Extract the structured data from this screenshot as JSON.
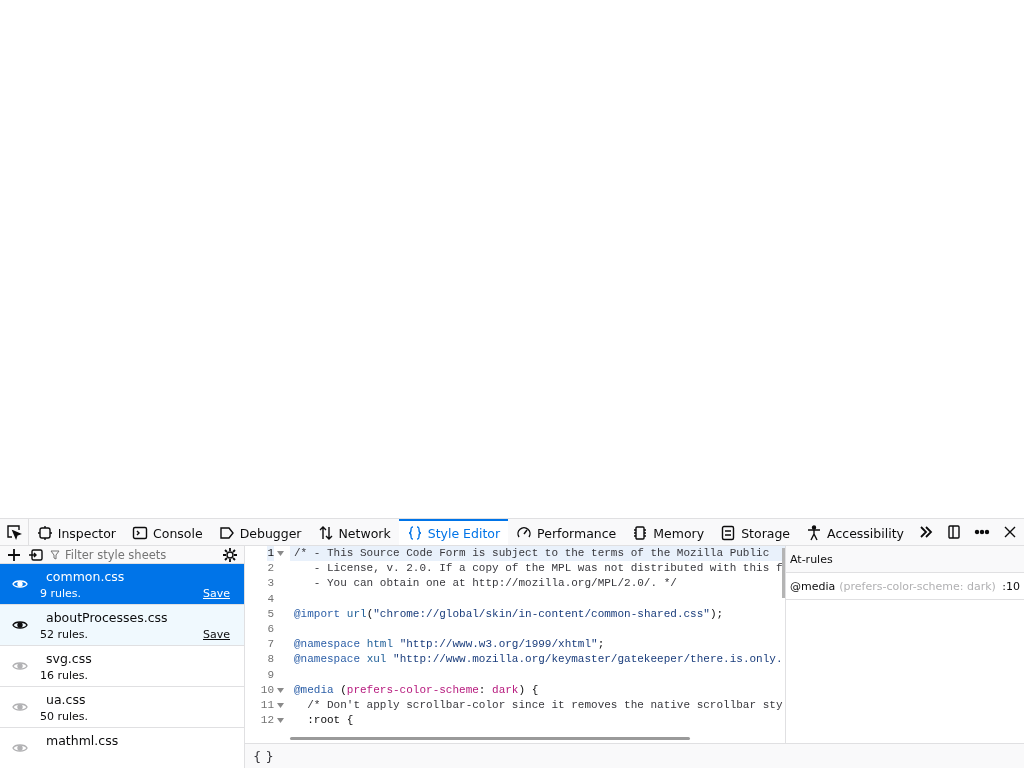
{
  "toolbar": {
    "tabs": [
      {
        "label": "Inspector",
        "selected": false
      },
      {
        "label": "Console",
        "selected": false
      },
      {
        "label": "Debugger",
        "selected": false
      },
      {
        "label": "Network",
        "selected": false
      },
      {
        "label": "Style Editor",
        "selected": true
      },
      {
        "label": "Performance",
        "selected": false
      },
      {
        "label": "Memory",
        "selected": false
      },
      {
        "label": "Storage",
        "selected": false
      },
      {
        "label": "Accessibility",
        "selected": false
      }
    ]
  },
  "sidebar": {
    "filter": {
      "placeholder": "Filter style sheets"
    },
    "sheets": [
      {
        "name": "common.css",
        "rules": "9 rules.",
        "save": "Save",
        "visible": true,
        "selected": true,
        "hovered": false
      },
      {
        "name": "aboutProcesses.css",
        "rules": "52 rules.",
        "save": "Save",
        "visible": true,
        "selected": false,
        "hovered": true
      },
      {
        "name": "svg.css",
        "rules": "16 rules.",
        "visible": false,
        "selected": false,
        "hovered": false
      },
      {
        "name": "ua.css",
        "rules": "50 rules.",
        "visible": false,
        "selected": false,
        "hovered": false
      },
      {
        "name": "mathml.css",
        "visible": false,
        "selected": false,
        "hovered": false
      }
    ]
  },
  "editor": {
    "lines": [
      {
        "number": "1",
        "fold": true,
        "active": true,
        "tokens": [
          {
            "kind": "comment",
            "text": "/* - This Source Code Form is subject to the terms of the Mozilla Public"
          }
        ]
      },
      {
        "number": "2",
        "fold": false,
        "active": false,
        "tokens": [
          {
            "kind": "comment",
            "text": "   - License, v. 2.0. If a copy of the MPL was not distributed with this f"
          }
        ]
      },
      {
        "number": "3",
        "fold": false,
        "active": false,
        "tokens": [
          {
            "kind": "comment",
            "text": "   - You can obtain one at http://mozilla.org/MPL/2.0/. */"
          }
        ]
      },
      {
        "number": "4",
        "fold": false,
        "active": false
      },
      {
        "number": "5",
        "fold": false,
        "active": false,
        "tokens": [
          {
            "kind": "keyword",
            "text": "@import "
          },
          {
            "kind": "function",
            "text": "url"
          },
          {
            "kind": "plain",
            "text": "("
          },
          {
            "kind": "string",
            "text": "\"chrome://global/skin/in-content/common-shared.css\""
          },
          {
            "kind": "plain",
            "text": ");"
          }
        ]
      },
      {
        "number": "6",
        "fold": false,
        "active": false
      },
      {
        "number": "7",
        "fold": false,
        "active": false,
        "tokens": [
          {
            "kind": "keyword",
            "text": "@namespace "
          },
          {
            "kind": "function",
            "text": "html "
          },
          {
            "kind": "string",
            "text": "\"http://www.w3.org/1999/xhtml\""
          },
          {
            "kind": "plain",
            "text": ";"
          }
        ]
      },
      {
        "number": "8",
        "fold": false,
        "active": false,
        "tokens": [
          {
            "kind": "keyword",
            "text": "@namespace "
          },
          {
            "kind": "function",
            "text": "xul "
          },
          {
            "kind": "string",
            "text": "\"http://www.mozilla.org/keymaster/gatekeeper/there.is.only."
          }
        ]
      },
      {
        "number": "9",
        "fold": false,
        "active": false
      },
      {
        "number": "10",
        "fold": true,
        "active": false,
        "tokens": [
          {
            "kind": "keyword",
            "text": "@media"
          },
          {
            "kind": "plain",
            "text": " ("
          },
          {
            "kind": "property",
            "text": "prefers-color-scheme"
          },
          {
            "kind": "plain",
            "text": ": "
          },
          {
            "kind": "property",
            "text": "dark"
          },
          {
            "kind": "plain",
            "text": ") {"
          }
        ]
      },
      {
        "number": "11",
        "fold": true,
        "active": false,
        "tokens": [
          {
            "kind": "comment",
            "text": "  /* Don't apply scrollbar-color since it removes the native scrollbar sty"
          }
        ]
      },
      {
        "number": "12",
        "fold": true,
        "active": false,
        "tokens": [
          {
            "kind": "plain",
            "text": "  :root {"
          }
        ]
      }
    ]
  },
  "at_rules": {
    "title": "At-rules",
    "rules": [
      {
        "keyword": "@media",
        "condition": "(prefers-color-scheme: dark)",
        "line": ":10"
      }
    ]
  },
  "footer": {
    "pretty_print": "{ }"
  }
}
